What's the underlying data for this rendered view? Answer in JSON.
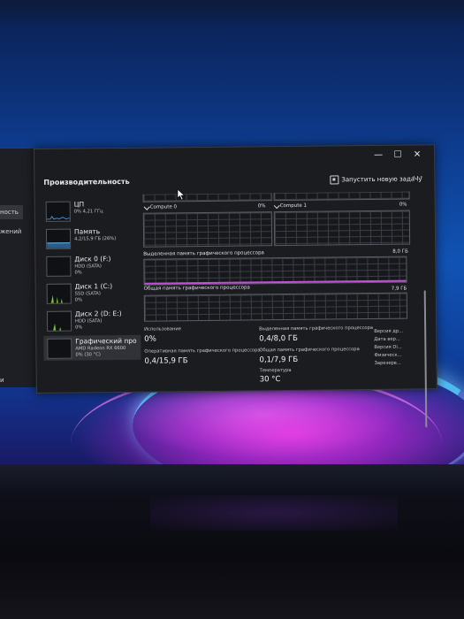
{
  "behind_window": {
    "items": [
      "ность",
      "жений",
      "и"
    ]
  },
  "window": {
    "minimize": "—",
    "maximize": "☐",
    "close": "✕",
    "title": "Производительность",
    "run_task": "Запустить новую задачу",
    "more": "···"
  },
  "sidebar": {
    "items": [
      {
        "name": "ЦП",
        "sub": "0% 4,21 ГГц",
        "icon": "cpu-graph"
      },
      {
        "name": "Память",
        "sub": "4,2/15,9 ГБ (26%)",
        "icon": "memory-graph"
      },
      {
        "name": "Диск 0 (F:)",
        "sub": "HDD (SATA)",
        "sub2": "0%",
        "icon": "disk-graph"
      },
      {
        "name": "Диск 1 (C:)",
        "sub": "SSD (SATA)",
        "sub2": "0%",
        "icon": "disk-graph"
      },
      {
        "name": "Диск 2 (D: E:)",
        "sub": "HDD (SATA)",
        "sub2": "0%",
        "icon": "disk-graph"
      },
      {
        "name": "Графический про",
        "sub": "AMD Radeon RX 6600",
        "sub2": "0% (30 °C)",
        "icon": "gpu-graph"
      }
    ]
  },
  "gpu": {
    "engine_left": {
      "name": "Compute 0",
      "value": "0%"
    },
    "engine_right": {
      "name": "Compute 1",
      "value": "0%"
    },
    "dedicated_label": "Выделенная память графического процессора",
    "dedicated_max": "8,0 ГБ",
    "shared_label": "Общая память графического процессора",
    "shared_max": "7,9 ГБ",
    "stats": {
      "usage_label": "Использование",
      "usage_value": "0%",
      "ram_label": "Оперативная память графического процессора",
      "ram_value": "0,4/15,9 ГБ",
      "ded_label": "Выделенная память графического процессора",
      "ded_value": "0,4/8,0 ГБ",
      "shared_label": "Общая память графического процессора",
      "shared_value": "0,1/7,9 ГБ",
      "temp_label": "Температура",
      "temp_value": "30 °C"
    },
    "info_labels": [
      "Версия др...",
      "Дата вер...",
      "Версия Di...",
      "Физическ...",
      "Зарезерв..."
    ]
  },
  "colors": {
    "window_bg": "#1b1c20",
    "graph_accent": "#c24fd8",
    "memory_accent": "#3b8fd6",
    "disk_accent": "#7cc63b"
  }
}
